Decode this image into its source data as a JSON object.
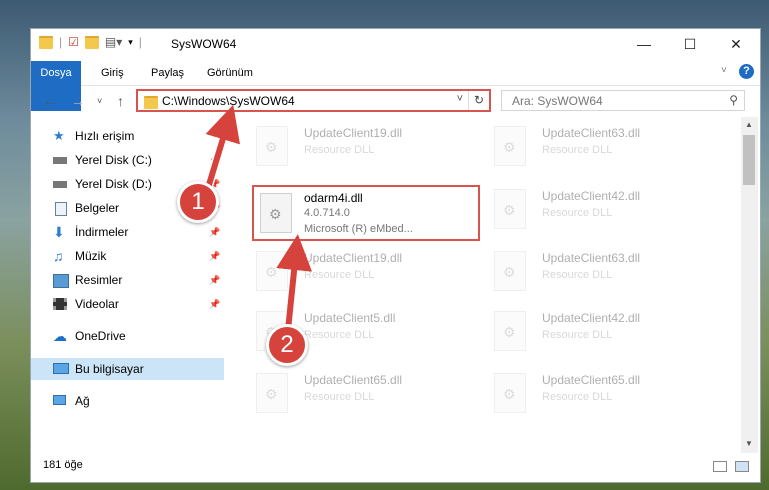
{
  "window": {
    "title": "SysWOW64"
  },
  "ribbon": {
    "tabs": [
      "Dosya",
      "Giriş",
      "Paylaş",
      "Görünüm"
    ]
  },
  "address": {
    "path": "C:\\Windows\\SysWOW64",
    "search_placeholder": "Ara: SysWOW64"
  },
  "sidebar": {
    "items": [
      {
        "label": "Hızlı erişim",
        "icon": "star-icon",
        "pinned": false
      },
      {
        "label": "Yerel Disk (C:)",
        "icon": "drive-icon",
        "pinned": true
      },
      {
        "label": "Yerel Disk (D:)",
        "icon": "drive-icon",
        "pinned": true
      },
      {
        "label": "Belgeler",
        "icon": "documents-icon",
        "pinned": true
      },
      {
        "label": "İndirmeler",
        "icon": "download-icon",
        "pinned": true
      },
      {
        "label": "Müzik",
        "icon": "music-icon",
        "pinned": true
      },
      {
        "label": "Resimler",
        "icon": "pictures-icon",
        "pinned": true
      },
      {
        "label": "Videolar",
        "icon": "videos-icon",
        "pinned": true
      },
      {
        "label": "OneDrive",
        "icon": "cloud-icon",
        "pinned": false
      },
      {
        "label": "Bu bilgisayar",
        "icon": "computer-icon",
        "pinned": false
      },
      {
        "label": "Ağ",
        "icon": "network-icon",
        "pinned": false
      }
    ]
  },
  "files": {
    "faded": [
      {
        "name": "UpdateClient19.dll",
        "desc": "Resource DLL"
      },
      {
        "name": "UpdateClient63.dll",
        "desc": "Resource DLL"
      },
      {
        "name": "UpdateClient42.dll",
        "desc": "Resource DLL"
      },
      {
        "name": "UpdateClient19.dll",
        "desc": "Resource DLL"
      },
      {
        "name": "UpdateClient63.dll",
        "desc": "Resource DLL"
      },
      {
        "name": "UpdateClient5.dll",
        "desc": "Resource DLL"
      },
      {
        "name": "UpdateClient42.dll",
        "desc": "Resource DLL"
      },
      {
        "name": "UpdateClient65.dll",
        "desc": "Resource DLL"
      },
      {
        "name": "UpdateClient65.dll",
        "desc": "Resource DLL"
      }
    ],
    "highlighted": {
      "name": "odarm4i.dll",
      "version": "4.0.714.0",
      "company": "Microsoft (R) eMbed..."
    }
  },
  "status": {
    "count": "181 öğe"
  },
  "callouts": [
    "1",
    "2"
  ],
  "colors": {
    "accent": "#1f6cc4",
    "highlight": "#d9534f",
    "selection": "#cce4f7"
  }
}
